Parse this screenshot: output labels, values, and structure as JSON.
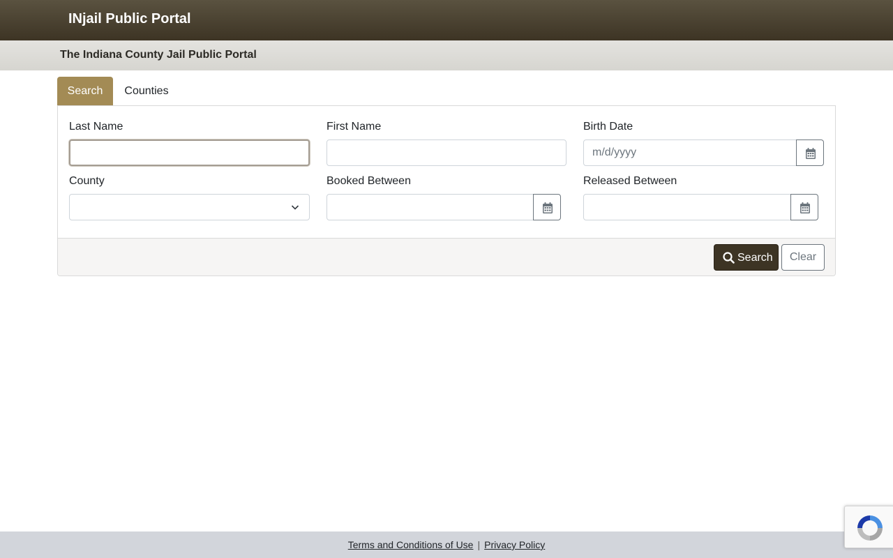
{
  "header": {
    "brand": "INjail Public Portal",
    "subtitle": "The Indiana County Jail Public Portal"
  },
  "tabs": [
    {
      "label": "Search",
      "active": true
    },
    {
      "label": "Counties",
      "active": false
    }
  ],
  "form": {
    "last_name": {
      "label": "Last Name",
      "value": ""
    },
    "first_name": {
      "label": "First Name",
      "value": ""
    },
    "birth_date": {
      "label": "Birth Date",
      "placeholder": "m/d/yyyy",
      "icon": "calendar-icon"
    },
    "county": {
      "label": "County",
      "selected": "",
      "icon": "chevron-down-icon"
    },
    "booked_between": {
      "label": "Booked Between",
      "value": "",
      "icon": "calendar-icon"
    },
    "released_between": {
      "label": "Released Between",
      "value": "",
      "icon": "calendar-icon"
    }
  },
  "actions": {
    "search_label": "Search",
    "search_icon": "search-icon",
    "clear_label": "Clear"
  },
  "footer": {
    "terms": "Terms and Conditions of Use",
    "separator": "|",
    "privacy": "Privacy Policy"
  },
  "colors": {
    "topbar": "#3d3424",
    "tab_active": "#a38b55",
    "search_button": "#3d3424",
    "footer": "#d2d5db"
  }
}
